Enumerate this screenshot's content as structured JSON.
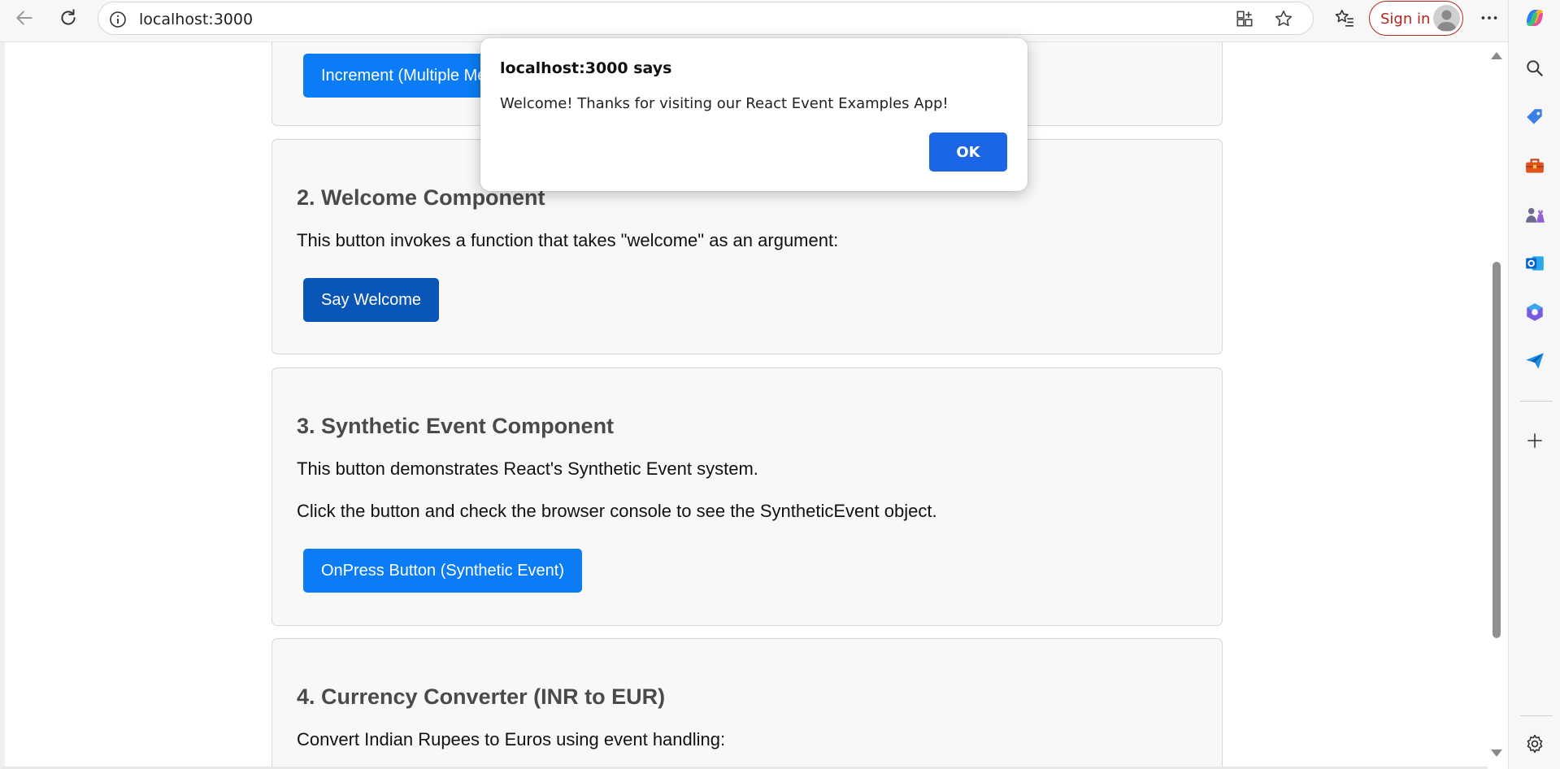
{
  "browser": {
    "url": "localhost:3000",
    "signin_label": "Sign in"
  },
  "page": {
    "card1": {
      "button_label": "Increment (Multiple Methods)"
    },
    "card2": {
      "heading": "2. Welcome Component",
      "description": "This button invokes a function that takes \"welcome\" as an argument:",
      "button_label": "Say Welcome"
    },
    "card3": {
      "heading": "3. Synthetic Event Component",
      "description1": "This button demonstrates React's Synthetic Event system.",
      "description2": "Click the button and check the browser console to see the SyntheticEvent object.",
      "button_label": "OnPress Button (Synthetic Event)"
    },
    "card4": {
      "heading": "4. Currency Converter (INR to EUR)",
      "description": "Convert Indian Rupees to Euros using event handling:"
    }
  },
  "dialog": {
    "title": "localhost:3000 says",
    "message": "Welcome! Thanks for visiting our React Event Examples App!",
    "ok_label": "OK"
  },
  "colors": {
    "accent_button": "#0b7cf5",
    "pressed_button": "#0a56b7",
    "dialog_ok": "#1a66e4",
    "signin": "#b3261e"
  },
  "icons": {
    "toolbar": [
      "back-icon",
      "refresh-icon",
      "info-icon",
      "apps-icon",
      "favorite-star-icon",
      "favorites-list-icon",
      "more-icon",
      "copilot-icon"
    ],
    "sidebar": [
      "search-icon",
      "tag-icon",
      "toolbox-icon",
      "games-icon",
      "outlook-icon",
      "microsoft365-icon",
      "send-icon",
      "add-icon",
      "settings-icon"
    ]
  }
}
